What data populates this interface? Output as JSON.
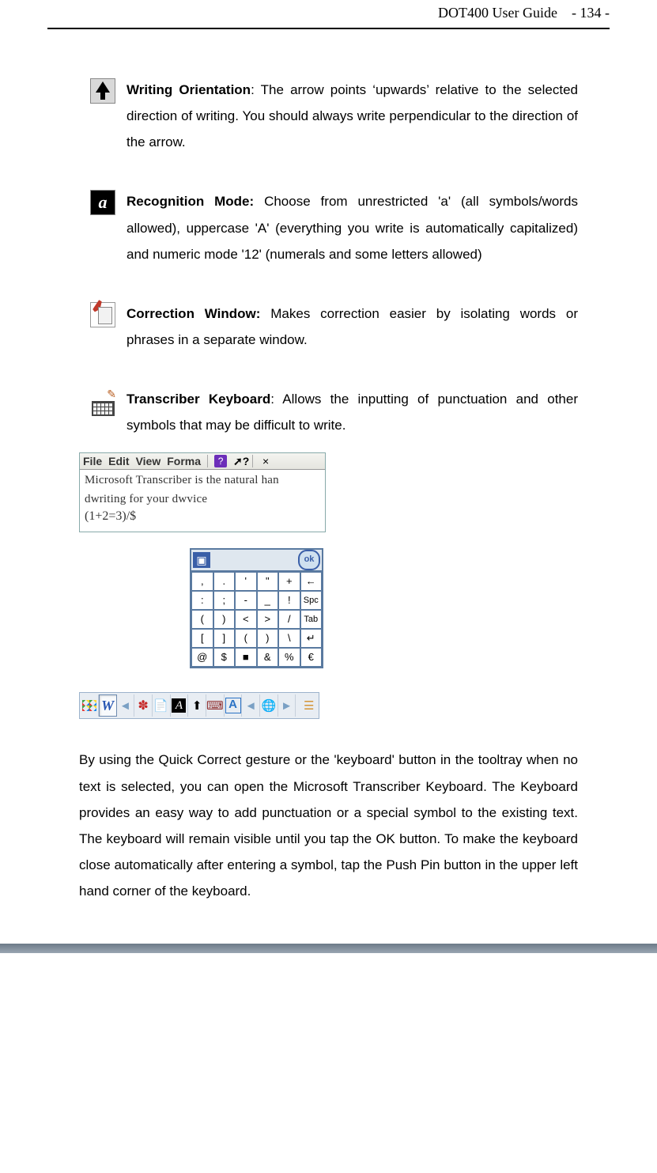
{
  "header": {
    "title": "DOT400 User Guide",
    "page": "- 134 -"
  },
  "entries": [
    {
      "heading": "Writing Orientation",
      "body": ": The arrow points ‘upwards’ relative to the selected direction of writing. You should always write perpendicular to the direction of the arrow."
    },
    {
      "heading": "Recognition Mode:",
      "body": " Choose from unrestricted 'a' (all symbols/words allowed), uppercase 'A' (everything you write is automatically capitalized) and numeric mode '12' (numerals and some letters allowed)"
    },
    {
      "heading": "Correction Window:",
      "body": " Makes correction easier by isolating words or phrases in a separate window."
    },
    {
      "heading": "Transcriber Keyboard",
      "body": ": Allows the inputting of punctuation and other symbols that may be difficult to write."
    }
  ],
  "ts_shot": {
    "menu": {
      "file": "File",
      "edit": "Edit",
      "view": "View",
      "format": "Forma",
      "q": "?",
      "help": "?",
      "close": "×"
    },
    "line1": "Microsoft Transcriber is the natural han",
    "line2": "dwriting for your dwvice",
    "math": "(1+2=3)/$"
  },
  "keyboard": {
    "pin_label": "▣",
    "ok_label": "ok",
    "rows": [
      [
        ",",
        ".",
        "'",
        "\"",
        "+",
        "←"
      ],
      [
        ":",
        ";",
        "-",
        "_",
        "!",
        "Spc"
      ],
      [
        "(",
        ")",
        "<",
        ">",
        "/",
        "Tab"
      ],
      [
        "[",
        "]",
        "(",
        ")",
        "\\",
        "↵"
      ],
      [
        "@",
        "$",
        "■",
        "&",
        "%",
        "€"
      ]
    ]
  },
  "tooltray_icons": {
    "start": "start-flag-icon",
    "w": "W",
    "gear": "✽",
    "note": "♪",
    "a_black": "A",
    "arrow_up": "⬆",
    "kbd": "⌨",
    "a_box": "A",
    "tri_left": "◄",
    "globe": "●",
    "tri_right": "►",
    "stack": "☰"
  },
  "paragraph": "By using the Quick Correct gesture or the 'keyboard' button in the tooltray when no text is selected, you can open the Microsoft Transcriber Keyboard. The Keyboard provides an easy way to add punctuation or a special symbol to the existing text. The keyboard will remain visible until you tap the OK button. To make the keyboard close automatically after entering a symbol, tap the Push Pin button in the upper left hand corner of the keyboard."
}
